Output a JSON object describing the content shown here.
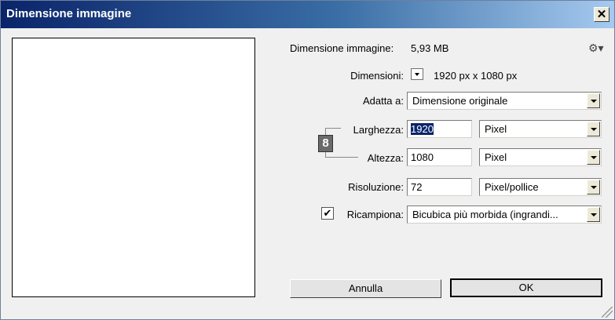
{
  "window": {
    "title": "Dimensione immagine",
    "close_label": "✕"
  },
  "info": {
    "image_size_label": "Dimensione immagine:",
    "image_size_value": "5,93 MB",
    "dimensions_label": "Dimensioni:",
    "dimensions_value": "1920 px  x  1080 px"
  },
  "fit": {
    "label": "Adatta a:",
    "value": "Dimensione originale"
  },
  "width": {
    "label": "Larghezza:",
    "value": "1920",
    "unit": "Pixel"
  },
  "height": {
    "label": "Altezza:",
    "value": "1080",
    "unit": "Pixel"
  },
  "resolution": {
    "label": "Risoluzione:",
    "value": "72",
    "unit": "Pixel/pollice"
  },
  "resample": {
    "label": "Ricampiona:",
    "checked": true,
    "check_mark": "✔",
    "value": "Bicubica più morbida (ingrandi..."
  },
  "buttons": {
    "cancel": "Annulla",
    "ok": "OK"
  },
  "icons": {
    "gear": "gear-icon",
    "link": "chain-link-icon"
  }
}
